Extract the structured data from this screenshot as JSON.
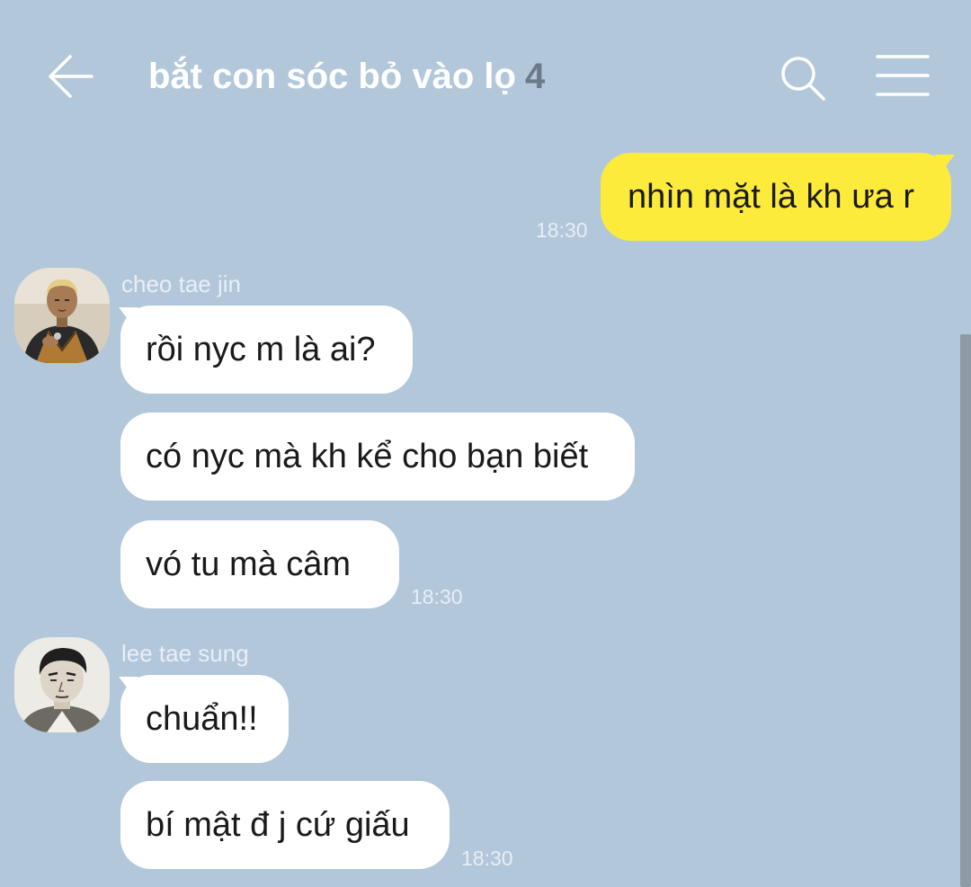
{
  "header": {
    "title": "bắt con sóc bỏ vào lọ",
    "member_count": "4",
    "back_icon": "arrow-left-icon",
    "search_icon": "search-icon",
    "menu_icon": "hamburger-menu-icon"
  },
  "colors": {
    "background": "#b2c7da",
    "incoming_bubble": "#ffffff",
    "outgoing_bubble": "#fdeb3c"
  },
  "messages": [
    {
      "direction": "outgoing",
      "text": "nhìn mặt là kh ưa r",
      "time": "18:30"
    },
    {
      "direction": "incoming",
      "sender": "cheo tae jin",
      "bubbles": [
        "rồi nyc m là ai?",
        "có nyc mà kh kể cho bạn biết",
        "vó tu mà câm"
      ],
      "time": "18:30"
    },
    {
      "direction": "incoming",
      "sender": "lee tae sung",
      "bubbles": [
        "chuẩn!!",
        "bí mật đ j cứ giấu"
      ],
      "time": "18:30"
    }
  ]
}
